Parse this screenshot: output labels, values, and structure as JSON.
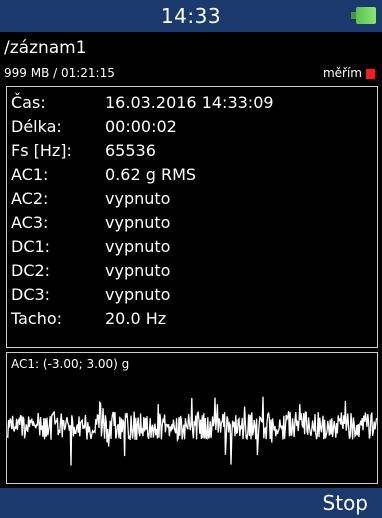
{
  "header": {
    "time": "14:33",
    "battery_icon": "battery-icon",
    "battery_color": "#7ed56f"
  },
  "recording": {
    "path": "/záznam1",
    "storage": "999 MB / 01:21:15",
    "measuring_label": "měřím",
    "indicator_color": "#ff1a1a"
  },
  "info": {
    "rows": [
      {
        "label": "Čas:",
        "value": "16.03.2016 14:33:09"
      },
      {
        "label": "Délka:",
        "value": "00:00:02"
      },
      {
        "label": "Fs [Hz]:",
        "value": "65536"
      },
      {
        "label": "AC1:",
        "value": "0.62 g RMS"
      },
      {
        "label": "AC2:",
        "value": "vypnuto"
      },
      {
        "label": "AC3:",
        "value": "vypnuto"
      },
      {
        "label": "DC1:",
        "value": "vypnuto"
      },
      {
        "label": "DC2:",
        "value": "vypnuto"
      },
      {
        "label": "DC3:",
        "value": "vypnuto"
      },
      {
        "label": "Tacho:",
        "value": "20.0 Hz"
      }
    ]
  },
  "graph": {
    "label": "AC1: (-3.00; 3.00) g",
    "signal_color": "#ffffff"
  },
  "footer": {
    "stop_label": "Stop"
  }
}
